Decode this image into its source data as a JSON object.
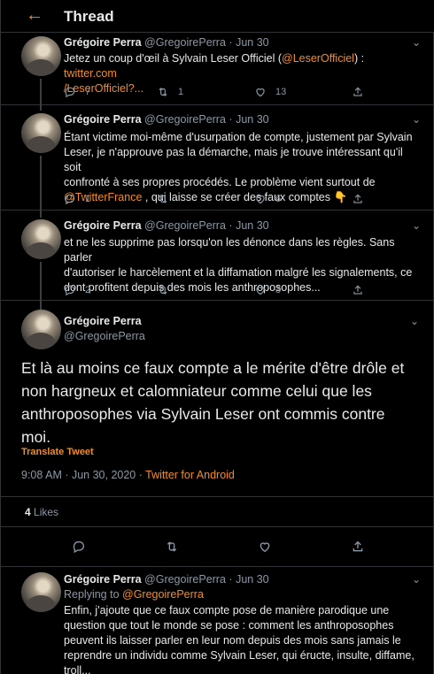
{
  "header": {
    "title": "Thread"
  },
  "tweets": [
    {
      "name": "Grégoire Perra",
      "handle": "@GregoirePerra",
      "sep": "·",
      "date": "Jun 30",
      "line1_text": "Jetez un coup d'œil à Sylvain Leser Officiel (",
      "line1_mention": "@LeserOfficiel",
      "line1_text2": ") : ",
      "line1_link": "twitter.com",
      "line2_link": "/LeserOfficiel?...",
      "replies": "7",
      "retweets": "1",
      "likes": "13"
    },
    {
      "name": "Grégoire Perra",
      "handle": "@GregoirePerra",
      "sep": "·",
      "date": "Jun 30",
      "line1": "Étant victime moi-même d'usurpation de compte, justement par Sylvain",
      "line2": "Leser,  je n'approuve pas la démarche, mais je trouve intéressant qu'il soit",
      "line3": "confronté à ses  propres procédés. Le problème vient surtout de",
      "line4_mention": "@TwitterFrance",
      "line4_text": " , qui laisse se créer des faux comptes 👇",
      "replies": "1",
      "retweets": "",
      "likes": "6"
    },
    {
      "name": "Grégoire Perra",
      "handle": "@GregoirePerra",
      "sep": "·",
      "date": "Jun 30",
      "line1": "et ne les supprime pas lorsqu'on les dénonce dans les règles. Sans parler",
      "line2": "d'autoriser le harcèlement et la diffamation malgré les signalements, ce",
      "line3": "dont profitent depuis des mois les anthroposophes...",
      "replies": "2",
      "retweets": "",
      "likes": "3"
    }
  ],
  "main": {
    "name": "Grégoire Perra",
    "handle": "@GregoirePerra",
    "text1": "Et là au moins ce faux compte a le mérite d'être drôle et",
    "text2": "non hargneux et calomniateur comme celui que les",
    "text3": "anthroposophes via Sylvain Leser ont commis contre",
    "text4": "moi.",
    "translate": "Translate Tweet",
    "time": "9:08 AM · Jun 30, 2020 · ",
    "source": "Twitter for Android",
    "likes_count": "4",
    "likes_label": " Likes"
  },
  "reply": {
    "name": "Grégoire Perra",
    "handle": "@GregoirePerra",
    "sep": "·",
    "date": "Jun 30",
    "replying_to": "Replying to ",
    "replying_mention": "@GregoirePerra",
    "line1": "Enfin, j'ajoute que ce faux compte pose de manière parodique une",
    "line2": "question que tout le monde se pose : comment les anthroposophes",
    "line3": "peuvent ils laisser parler en leur nom depuis des mois sans jamais le",
    "line4": "reprendre un individu comme Sylvain Leser, qui éructe, insulte, diffame,",
    "line5": "troll..."
  },
  "icons": [
    "back-arrow-icon",
    "reply-icon",
    "retweet-icon",
    "like-icon",
    "share-icon",
    "chevron-down-icon"
  ],
  "colors": {
    "accent": "#f18c2d",
    "background": "#000000",
    "muted": "#8b98a5",
    "text": "#e7e9ea",
    "border": "#2f3336"
  }
}
